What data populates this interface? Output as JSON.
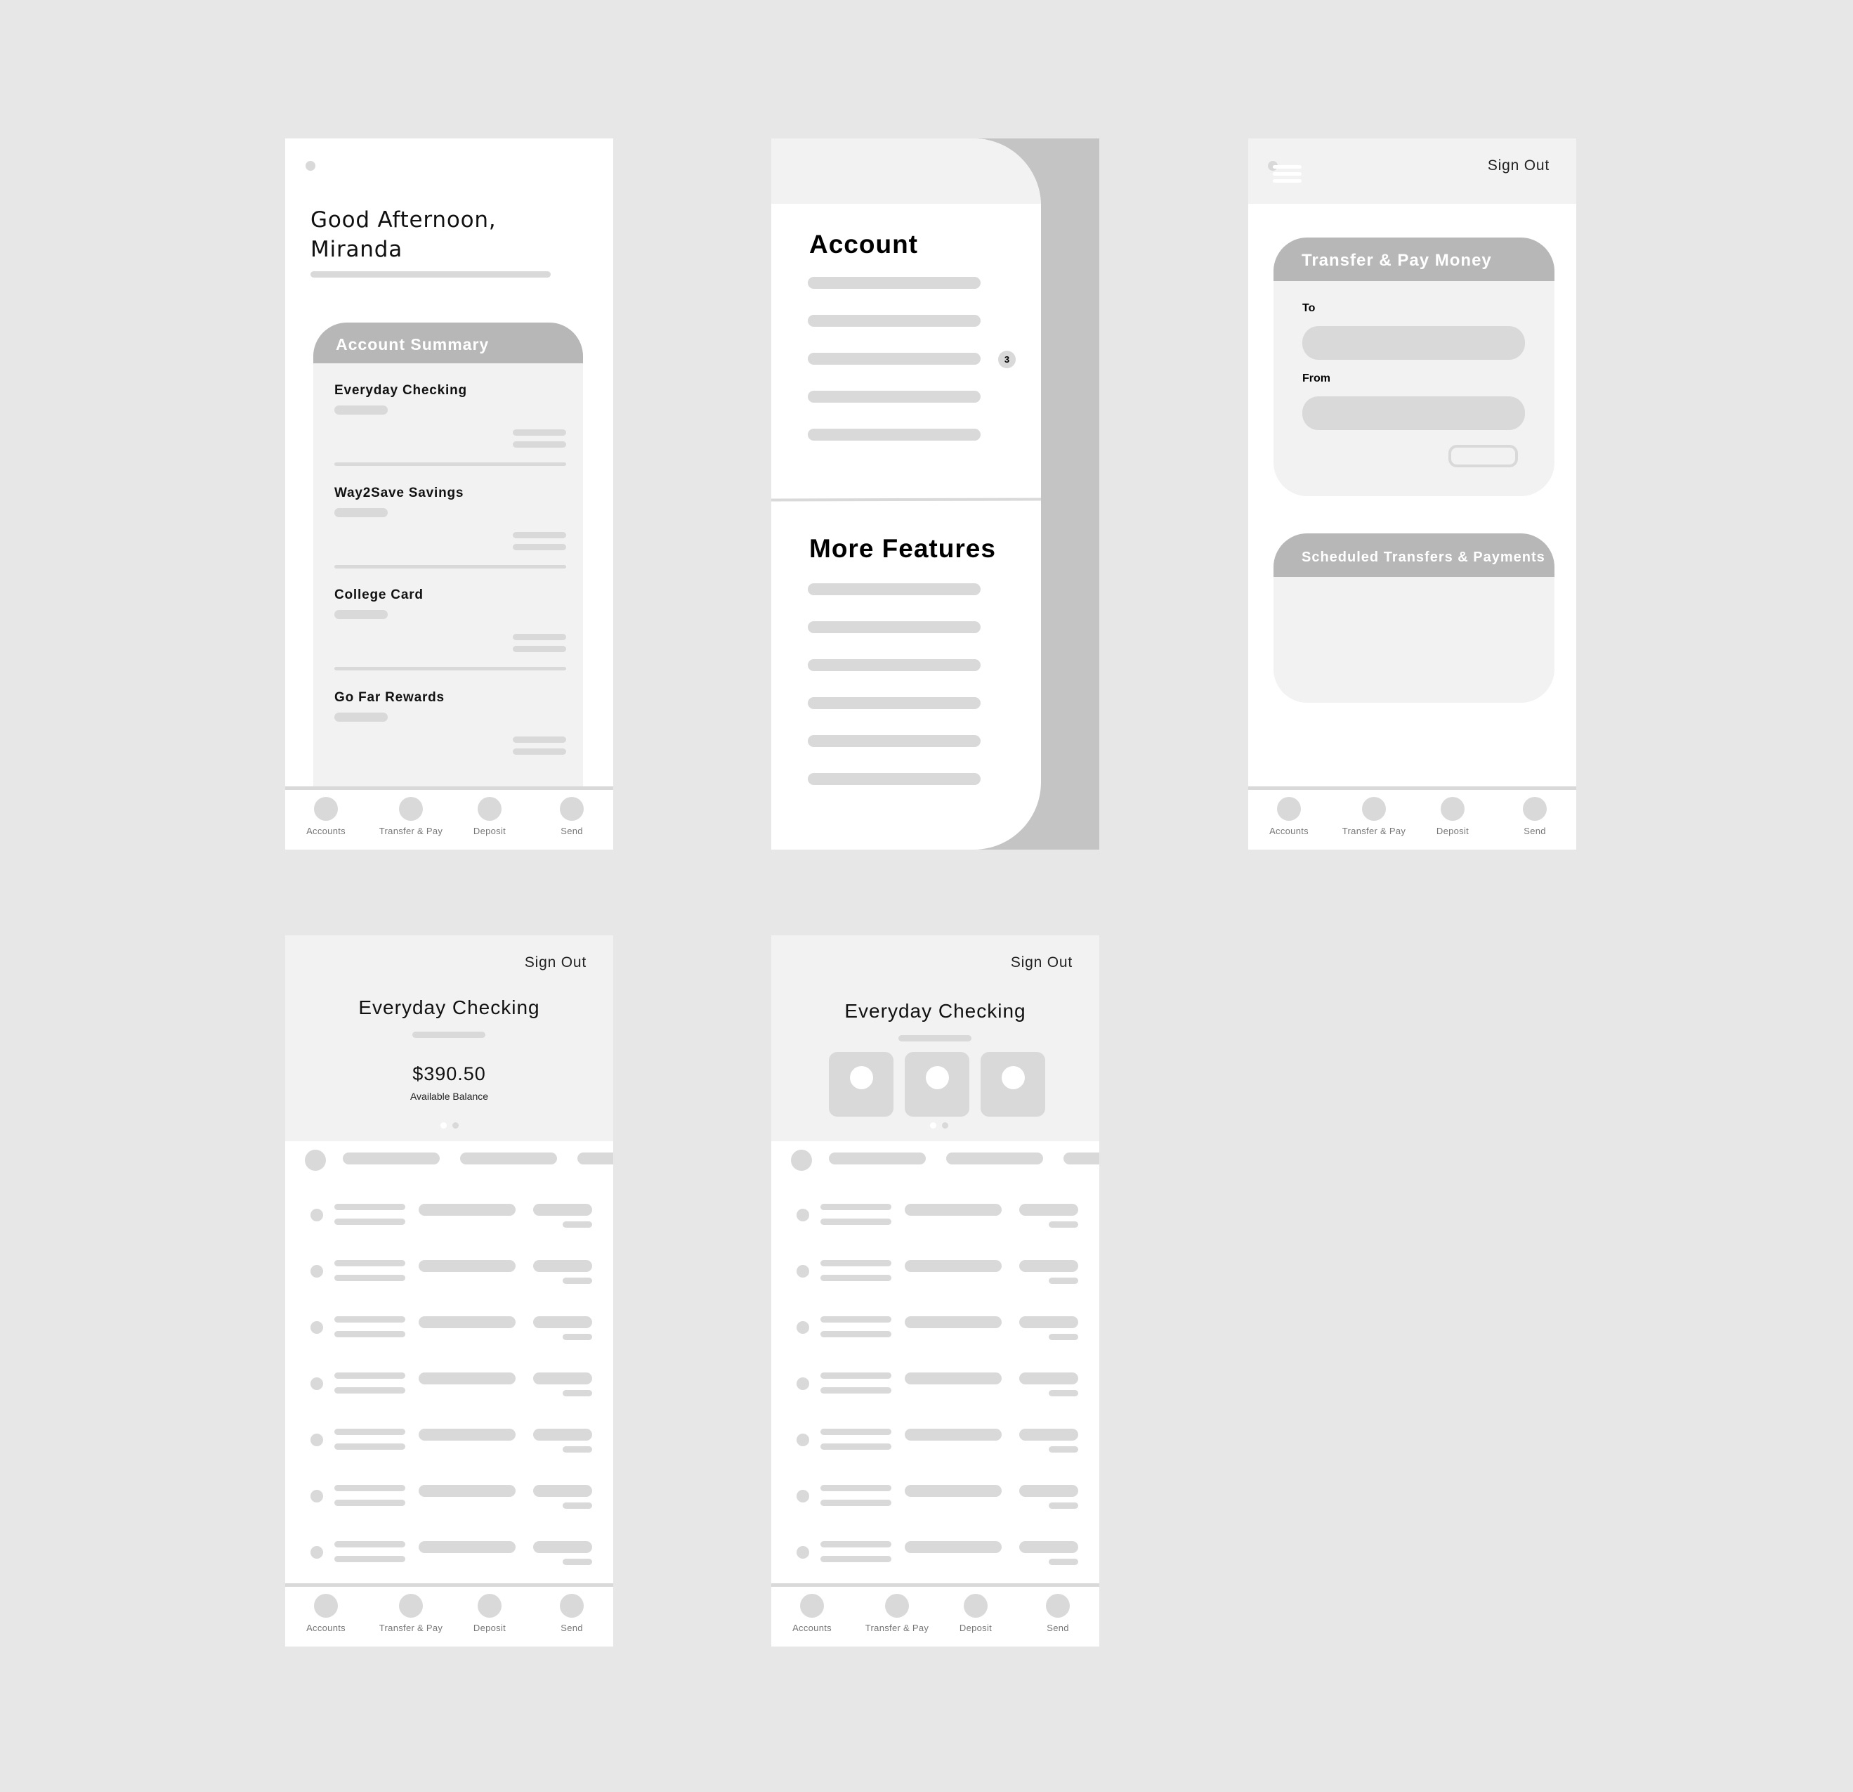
{
  "bottom_nav": {
    "items": [
      {
        "label": "Accounts",
        "icon": "circle-placeholder-icon"
      },
      {
        "label": "Transfer & Pay",
        "icon": "circle-placeholder-icon"
      },
      {
        "label": "Deposit",
        "icon": "circle-placeholder-icon"
      },
      {
        "label": "Send",
        "icon": "circle-placeholder-icon"
      }
    ]
  },
  "home_screen": {
    "greeting_line1": "Good Afternoon,",
    "greeting_line2": "Miranda",
    "summary_title": "Account Summary",
    "accounts": [
      {
        "name": "Everyday Checking"
      },
      {
        "name": "Way2Save Savings"
      },
      {
        "name": "College Card"
      },
      {
        "name": "Go Far Rewards"
      }
    ]
  },
  "menu_screen": {
    "account_section_title": "Account",
    "account_item_count": 5,
    "badge": {
      "item_index": 2,
      "count": "3"
    },
    "more_section_title": "More Features",
    "more_item_count": 6
  },
  "transfer_screen": {
    "sign_out": "Sign Out",
    "menu_icon": "hamburger-icon",
    "transfer_card_title": "Transfer & Pay Money",
    "to_label": "To",
    "to_value": "",
    "from_label": "From",
    "from_value": "",
    "scheduled_card_title": "Scheduled Transfers & Payments"
  },
  "account_detail_screen": {
    "sign_out": "Sign Out",
    "account_name": "Everyday Checking",
    "balance": "$390.50",
    "balance_label": "Available Balance",
    "pager": {
      "pages": 2,
      "active": 1
    },
    "transaction_rows": 7
  },
  "account_actions_screen": {
    "sign_out": "Sign Out",
    "account_name": "Everyday Checking",
    "quick_actions": 3,
    "pager": {
      "pages": 2,
      "active": 1
    },
    "transaction_rows": 7
  },
  "colors": {
    "canvas": "#e7e7e7",
    "panel": "#f2f2f2",
    "placeholder": "#d9d9d9",
    "card_header": "#b7b7b7",
    "drawer_overlay": "#c4c4c4"
  }
}
